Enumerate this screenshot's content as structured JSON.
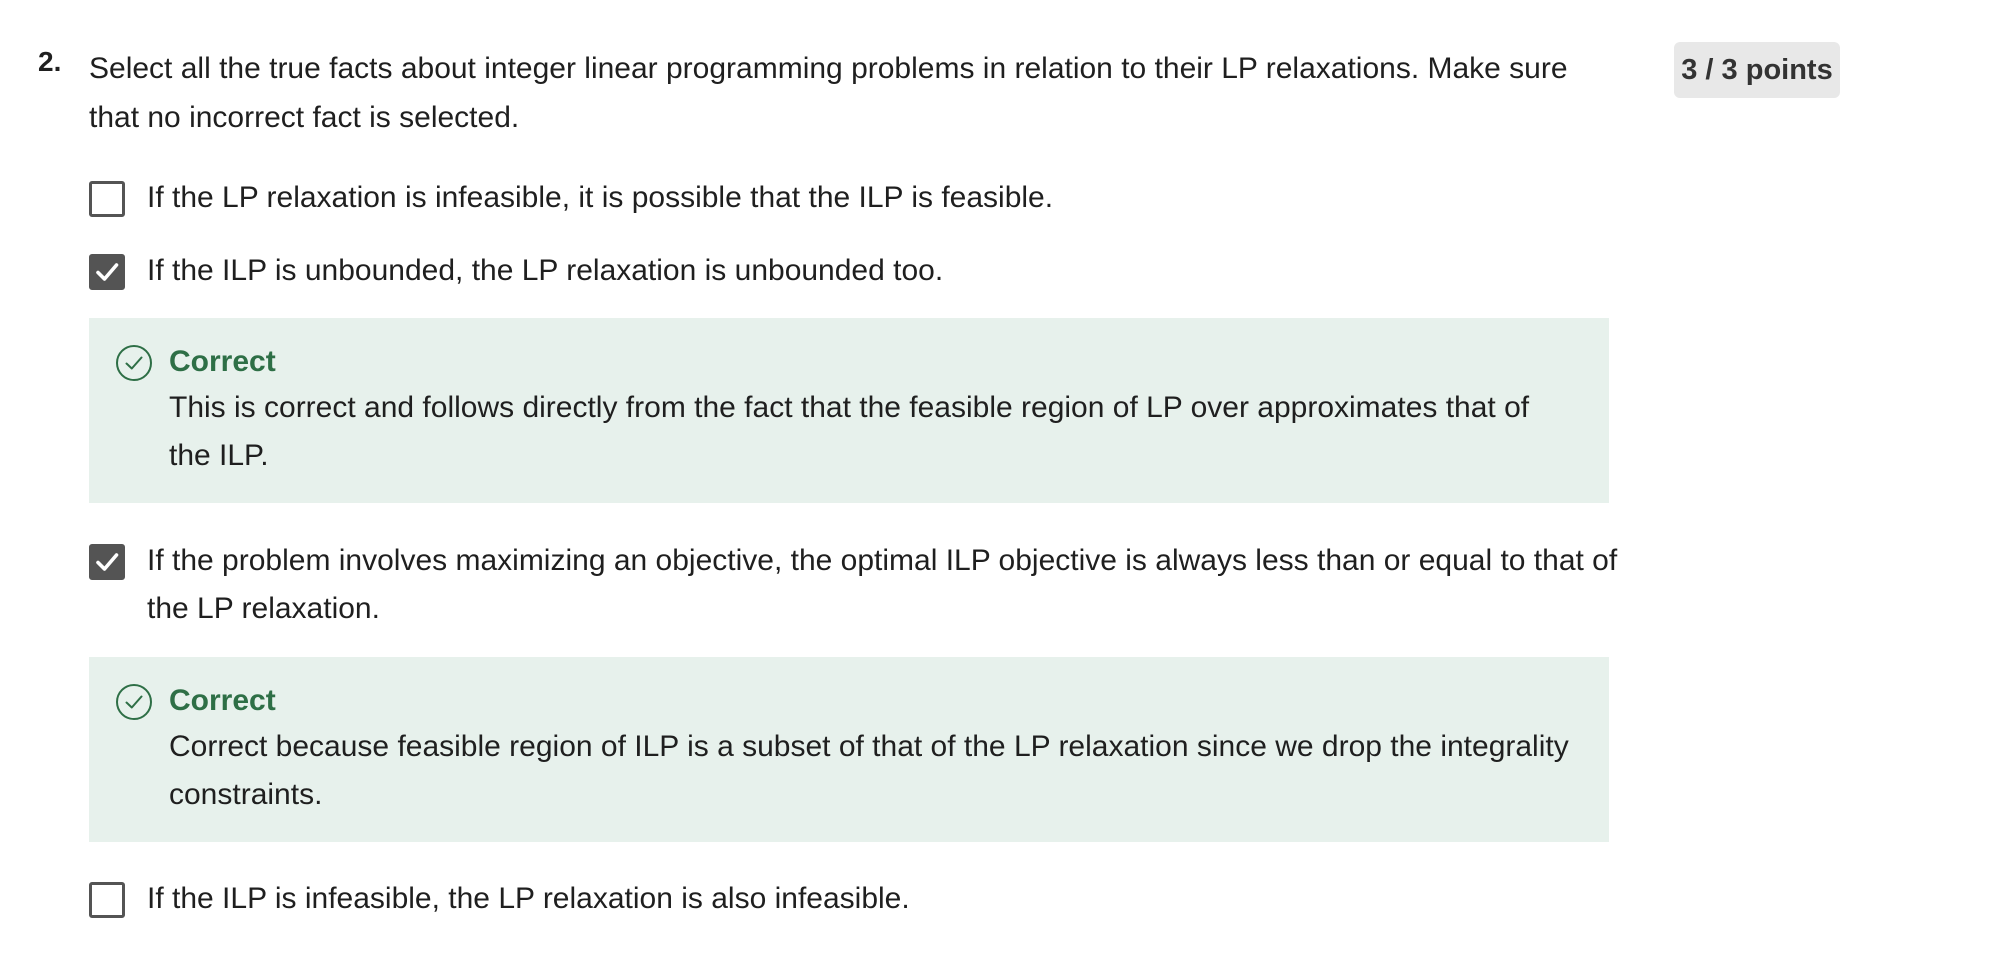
{
  "question": {
    "number": "2.",
    "text": "Select all the true facts about integer linear programming problems in relation to their LP relaxations. Make sure that no incorrect fact is selected.",
    "points": "3 / 3 points"
  },
  "options": [
    {
      "label": "If the LP relaxation is infeasible, it is possible that the ILP  is feasible.",
      "checked": false
    },
    {
      "label": "If the ILP is unbounded, the LP relaxation is unbounded too.",
      "checked": true,
      "feedback": {
        "title": "Correct",
        "text": "This is correct and follows directly from the fact that the feasible region of LP over approximates that of the ILP."
      }
    },
    {
      "label": "If the problem involves maximizing an objective, the optimal ILP objective is always less than or equal to that of the LP relaxation.",
      "checked": true,
      "feedback": {
        "title": "Correct",
        "text": "Correct because feasible region of ILP is a subset of that of the LP relaxation since we drop the integrality constraints."
      }
    },
    {
      "label": "If the ILP  is infeasible, the LP relaxation is also infeasible.",
      "checked": false
    }
  ],
  "colors": {
    "checkbox": "#545454",
    "correct_text": "#2e6f46",
    "feedback_background": "#e7f1ec",
    "points_background": "#e8e8e8"
  },
  "icons": {
    "checkmark": "checkmark-icon",
    "correct": "check-circle-icon"
  }
}
